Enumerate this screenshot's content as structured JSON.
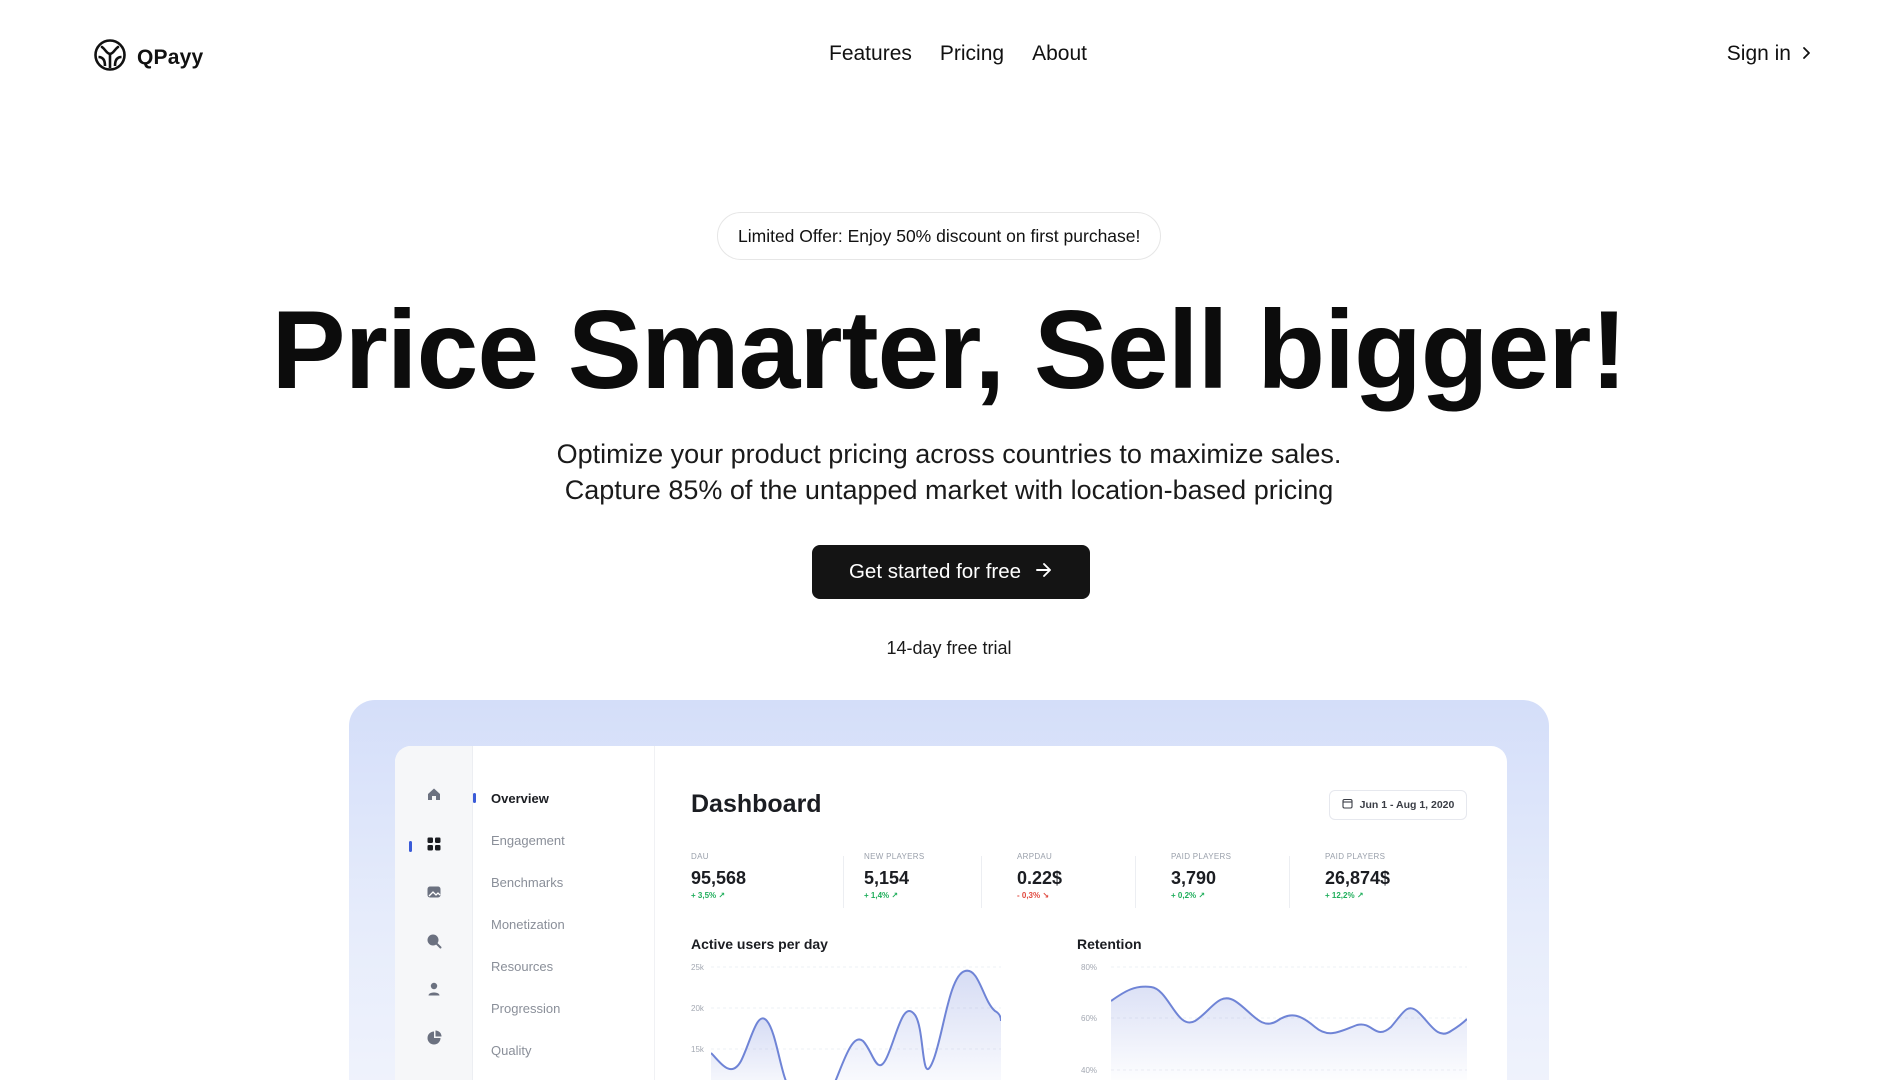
{
  "brand": {
    "name": "QPayy",
    "logo_icon": "qpayy-logo-icon"
  },
  "nav": {
    "links": [
      "Features",
      "Pricing",
      "About"
    ],
    "signin_label": "Sign in"
  },
  "hero": {
    "offer": "Limited Offer: Enjoy 50% discount on first purchase!",
    "headline": "Price Smarter, Sell bigger!",
    "sub_line_1": "Optimize your product pricing across countries to maximize sales.",
    "sub_line_2": "Capture 85% of the untapped market with location-based pricing",
    "cta_label": "Get started for free",
    "trial_note": "14-day free trial"
  },
  "dashboard": {
    "title": "Dashboard",
    "date_range": "Jun 1 - Aug 1, 2020",
    "sidebar_icons": [
      "home-icon",
      "grid-icon",
      "image-icon",
      "search-icon",
      "user-icon",
      "pie-chart-icon"
    ],
    "menu": [
      "Overview",
      "Engagement",
      "Benchmarks",
      "Monetization",
      "Resources",
      "Progression",
      "Quality"
    ],
    "stats": [
      {
        "label": "DAU",
        "value": "95,568",
        "delta": "+ 3,5%",
        "trend": "up"
      },
      {
        "label": "NEW PLAYERS",
        "value": "5,154",
        "delta": "+ 1,4%",
        "trend": "up"
      },
      {
        "label": "ARPDAU",
        "value": "0.22$",
        "delta": "- 0,3%",
        "trend": "down"
      },
      {
        "label": "PAID PLAYERS",
        "value": "3,790",
        "delta": "+ 0,2%",
        "trend": "up"
      },
      {
        "label": "PAID PLAYERS",
        "value": "26,874$",
        "delta": "+ 12,2%",
        "trend": "up"
      }
    ],
    "charts": {
      "active_users": {
        "title": "Active users per day",
        "y_ticks": [
          "25k",
          "20k",
          "15k"
        ]
      },
      "retention": {
        "title": "Retention",
        "y_ticks": [
          "80%",
          "60%",
          "40%"
        ]
      }
    }
  },
  "colors": {
    "cta_bg": "#141414",
    "frame_bg": "#d4def9",
    "accent": "#3a5bd8",
    "line": "#6f84d6",
    "positive": "#1fae5b",
    "negative": "#e0483e"
  }
}
